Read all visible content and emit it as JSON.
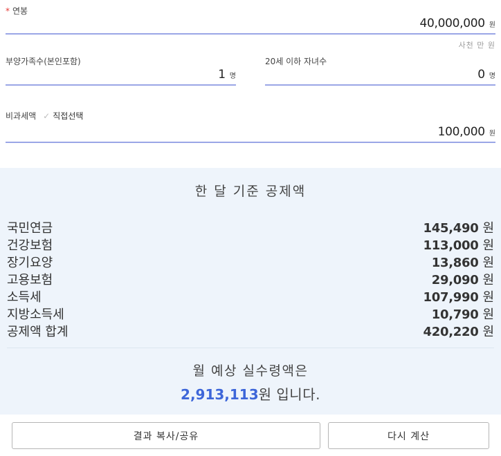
{
  "form": {
    "salary": {
      "required_mark": "*",
      "label": "연봉",
      "value": "40,000,000",
      "unit": "원",
      "hint": "사천 만 원"
    },
    "dependents": {
      "label": "부양가족수(본인포함)",
      "value": "1",
      "unit": "명"
    },
    "children": {
      "label": "20세 이하 자녀수",
      "value": "0",
      "unit": "명"
    },
    "nontax": {
      "label": "비과세액",
      "check_label": "직접선택",
      "value": "100,000",
      "unit": "원"
    }
  },
  "deductions": {
    "title": "한 달 기준 공제액",
    "unit": "원",
    "items": [
      {
        "name": "국민연금",
        "value": "145,490"
      },
      {
        "name": "건강보험",
        "value": "113,000"
      },
      {
        "name": "장기요양",
        "value": "13,860"
      },
      {
        "name": "고용보험",
        "value": "29,090"
      },
      {
        "name": "소득세",
        "value": "107,990"
      },
      {
        "name": "지방소득세",
        "value": "10,790"
      },
      {
        "name": "공제액 합계",
        "value": "420,220"
      }
    ]
  },
  "result": {
    "label": "월 예상 실수령액은",
    "amount": "2,913,113",
    "suffix": "원 입니다."
  },
  "buttons": {
    "copy_share": "결과 복사/공유",
    "recalculate": "다시 계산"
  },
  "colors": {
    "accent": "#3d66d9",
    "underline": "#9aa6e6",
    "panel_bg": "#eef4fb",
    "required": "#e53935"
  }
}
